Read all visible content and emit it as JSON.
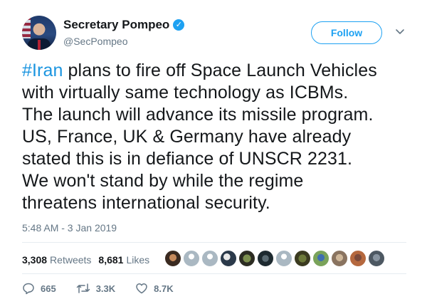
{
  "author": {
    "display_name": "Secretary Pompeo",
    "handle": "@SecPompeo",
    "verified": true
  },
  "follow_button": {
    "label": "Follow"
  },
  "tweet": {
    "hashtag": "#Iran",
    "lines": [
      " plans to fire off Space Launch Vehicles",
      "with virtually same technology as ICBMs.",
      "The launch will advance its missile program.",
      "US, France, UK & Germany have already",
      "stated this is in defiance of UNSCR 2231.",
      "We won't stand by while the regime",
      "threatens international security."
    ],
    "timestamp": "5:48 AM - 3 Jan 2019"
  },
  "stats": {
    "retweets_count": "3,308",
    "retweets_label": "Retweets",
    "likes_count": "8,681",
    "likes_label": "Likes"
  },
  "actions": {
    "replies": "665",
    "retweets": "3.3K",
    "likes": "8.7K"
  },
  "colors": {
    "accent": "#1da1f2",
    "hashtag": "#1b95e0",
    "muted": "#657786"
  },
  "icons": [
    "verified-badge-icon",
    "chevron-down-icon",
    "reply-icon",
    "retweet-icon",
    "like-icon"
  ]
}
